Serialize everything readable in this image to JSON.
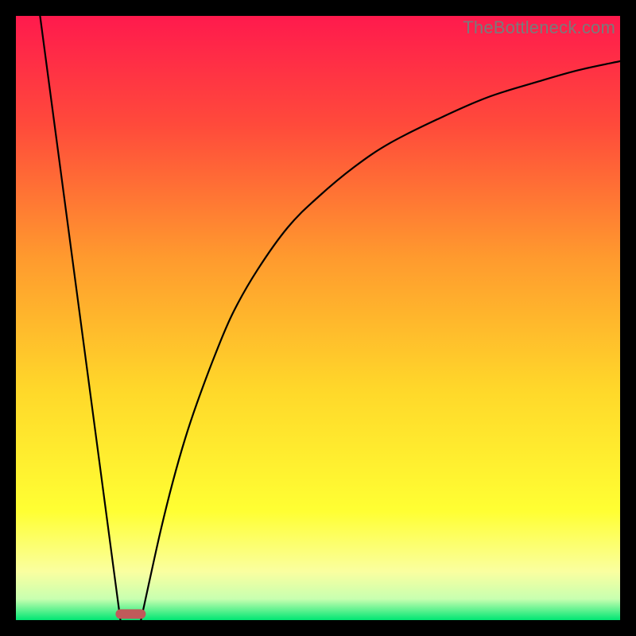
{
  "watermark": "TheBottleneck.com",
  "chart_data": {
    "type": "line",
    "title": "",
    "xlabel": "",
    "ylabel": "",
    "xlim": [
      0,
      100
    ],
    "ylim": [
      0,
      100
    ],
    "grid": false,
    "background_gradient": {
      "stops": [
        {
          "offset": 0.0,
          "color": "#ff1a4d"
        },
        {
          "offset": 0.18,
          "color": "#ff4a3b"
        },
        {
          "offset": 0.4,
          "color": "#ff9a2e"
        },
        {
          "offset": 0.62,
          "color": "#ffd82a"
        },
        {
          "offset": 0.82,
          "color": "#ffff33"
        },
        {
          "offset": 0.92,
          "color": "#faffa0"
        },
        {
          "offset": 0.965,
          "color": "#c8ffb0"
        },
        {
          "offset": 1.0,
          "color": "#00e673"
        }
      ]
    },
    "marker": {
      "x_center": 19.0,
      "width": 5.0,
      "y": 1.0,
      "color": "#c05a5a"
    },
    "series": [
      {
        "name": "left-line",
        "type": "line",
        "x": [
          4.0,
          17.3
        ],
        "y": [
          100.0,
          0.0
        ]
      },
      {
        "name": "right-curve",
        "type": "line",
        "x": [
          20.7,
          22,
          24,
          26,
          28,
          30,
          33,
          36,
          40,
          45,
          50,
          56,
          62,
          70,
          78,
          86,
          93,
          100
        ],
        "y": [
          0.0,
          6,
          15,
          23,
          30,
          36,
          44,
          51,
          58,
          65,
          70,
          75,
          79,
          83,
          86.5,
          89,
          91,
          92.5
        ]
      }
    ]
  }
}
